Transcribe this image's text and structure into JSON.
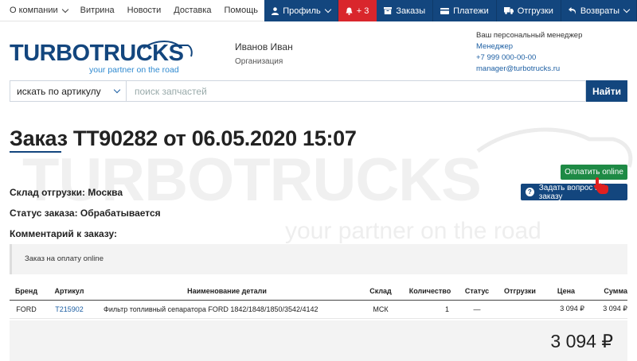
{
  "topnav": {
    "items": [
      {
        "label": "О компании",
        "dropdown": true
      },
      {
        "label": "Витрина"
      },
      {
        "label": "Новости"
      },
      {
        "label": "Доставка"
      },
      {
        "label": "Помощь"
      }
    ]
  },
  "rightnav": {
    "profile": "Профиль",
    "notifications": "+ 3",
    "orders": "Заказы",
    "payments": "Платежи",
    "shipments": "Отгрузки",
    "returns": "Возвраты"
  },
  "logo": {
    "brand": "TURBOTRUCKS",
    "slogan": "your partner on the road"
  },
  "user": {
    "name": "Иванов Иван",
    "org": "Организация"
  },
  "manager": {
    "title": "Ваш персональный менеджер",
    "name": "Менеджер",
    "phone": "+7 999 000-00-00",
    "email": "manager@turbotrucks.ru"
  },
  "search": {
    "mode": "искать по артикулу",
    "placeholder": "поиск запчастей",
    "button": "Найти"
  },
  "order": {
    "title": "Заказ ТТ90282 от 06.05.2020 15:07",
    "warehouse": "Склад отгрузки: Москва",
    "status": "Статус заказа: Обрабатывается",
    "comment_label": "Комментарий к заказу:",
    "comment": "Заказ на оплату online",
    "pay_button": "Оплатить online",
    "question_button": "Задать вопрос по заказу"
  },
  "table": {
    "headers": [
      "Бренд",
      "Артикул",
      "Наименование детали",
      "Склад",
      "Количество",
      "Статус",
      "Отгрузки",
      "Цена",
      "Сумма"
    ],
    "rows": [
      [
        "FORD",
        "T215902",
        "Фильтр топливный сепаратора FORD 1842/1848/1850/3542/4142",
        "МСК",
        "1",
        "—",
        "",
        "3 094 ₽",
        "3 094 ₽"
      ]
    ]
  },
  "total": "3 094 ₽",
  "colors": {
    "navy": "#13467e",
    "green": "#1e8a45",
    "red": "#d9262c",
    "link": "#1d5fa3"
  }
}
